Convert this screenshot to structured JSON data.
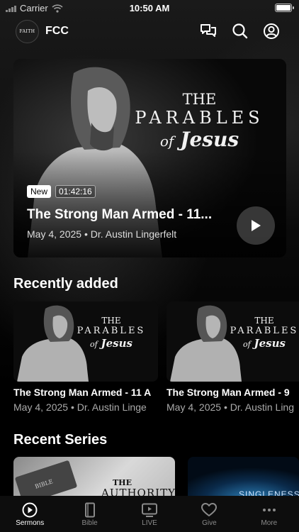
{
  "status_bar": {
    "carrier": "Carrier",
    "time": "10:50 AM"
  },
  "header": {
    "logo_text": "FAITH",
    "title": "FCC"
  },
  "hero": {
    "artwork": {
      "line1": "THE",
      "line2": "PARABLES",
      "line3_a": "of",
      "line3_b": "Jesus"
    },
    "badge_new": "New",
    "duration": "01:42:16",
    "title": "The Strong Man Armed - 11...",
    "meta": "May 4, 2025 • Dr. Austin Lingerfelt"
  },
  "recently_added": {
    "heading": "Recently added",
    "items": [
      {
        "title": "The Strong Man Armed - 11 A",
        "meta": "May 4, 2025 • Dr. Austin Linge",
        "artwork": {
          "line1": "THE",
          "line2": "PARABLES",
          "line3_a": "of",
          "line3_b": "Jesus"
        }
      },
      {
        "title": "The Strong Man Armed - 9",
        "meta": "May 4, 2025 • Dr. Austin Ling",
        "artwork": {
          "line1": "THE",
          "line2": "PARABLES",
          "line3_a": "of",
          "line3_b": "Jesus"
        }
      }
    ]
  },
  "recent_series": {
    "heading": "Recent Series",
    "items": [
      {
        "art_label_small": "BIBLE",
        "art_label_the": "THE",
        "art_label": "AUTHORITY"
      },
      {
        "art_label": "SINGLENESS"
      }
    ]
  },
  "tabs": [
    {
      "label": "Sermons",
      "icon": "play-circle-icon",
      "active": true
    },
    {
      "label": "Bible",
      "icon": "book-icon",
      "active": false
    },
    {
      "label": "LIVE",
      "icon": "tv-icon",
      "active": false
    },
    {
      "label": "Give",
      "icon": "heart-icon",
      "active": false
    },
    {
      "label": "More",
      "icon": "ellipsis-icon",
      "active": false
    }
  ]
}
